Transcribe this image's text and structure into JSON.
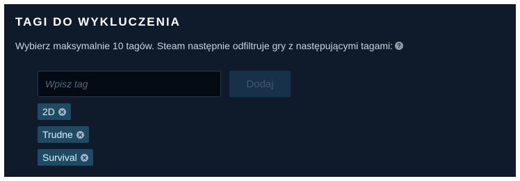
{
  "section": {
    "title": "TAGI DO WYKLUCZENIA",
    "description": "Wybierz maksymalnie 10 tagów. Steam następnie odfiltruje gry z następującymi tagami:",
    "help_icon": "question-mark-icon",
    "help_glyph": "?"
  },
  "input": {
    "placeholder": "Wpisz tag",
    "value": ""
  },
  "add_button": {
    "label": "Dodaj"
  },
  "tags": [
    {
      "label": "2D",
      "remove_icon": "remove-icon"
    },
    {
      "label": "Trudne",
      "remove_icon": "remove-icon"
    },
    {
      "label": "Survival",
      "remove_icon": "remove-icon"
    }
  ],
  "colors": {
    "panel_background": "#0f1a2a",
    "tag_background": "#1f4a63",
    "button_background": "#17314a",
    "text": "#c6d4df"
  }
}
